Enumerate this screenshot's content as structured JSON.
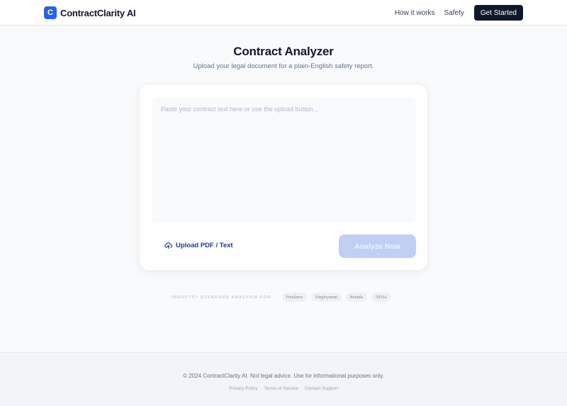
{
  "header": {
    "logo_letter": "C",
    "brand_name": "ContractClarity AI",
    "nav": [
      "How it works",
      "Safety"
    ],
    "cta_label": "Get Started"
  },
  "hero": {
    "title": "Contract Analyzer",
    "subtitle": "Upload your legal document for a plain-English safety report."
  },
  "editor": {
    "value": "",
    "placeholder": "Paste your contract text here or use the upload button...",
    "upload_icon": "cloud-upload-icon",
    "upload_label": "Upload PDF / Text",
    "analyze_label": "Analyze Now"
  },
  "industries": {
    "label": "INDUSTRY STANDARD ANALYSIS FOR:",
    "tags": [
      "Freelance",
      "Employment",
      "Rentals",
      "NDAs"
    ]
  },
  "footer": {
    "copyright": "© 2024 ContractClarity AI. Not legal advice. Use for informational purposes only.",
    "links": [
      "Privacy Policy",
      "Terms of Service",
      "Contact Support"
    ]
  },
  "colors": {
    "brand": "#2563eb",
    "dark": "#0f172a",
    "analyze_disabled": "#bfd0f4",
    "upload_text": "#1e3a8a"
  }
}
